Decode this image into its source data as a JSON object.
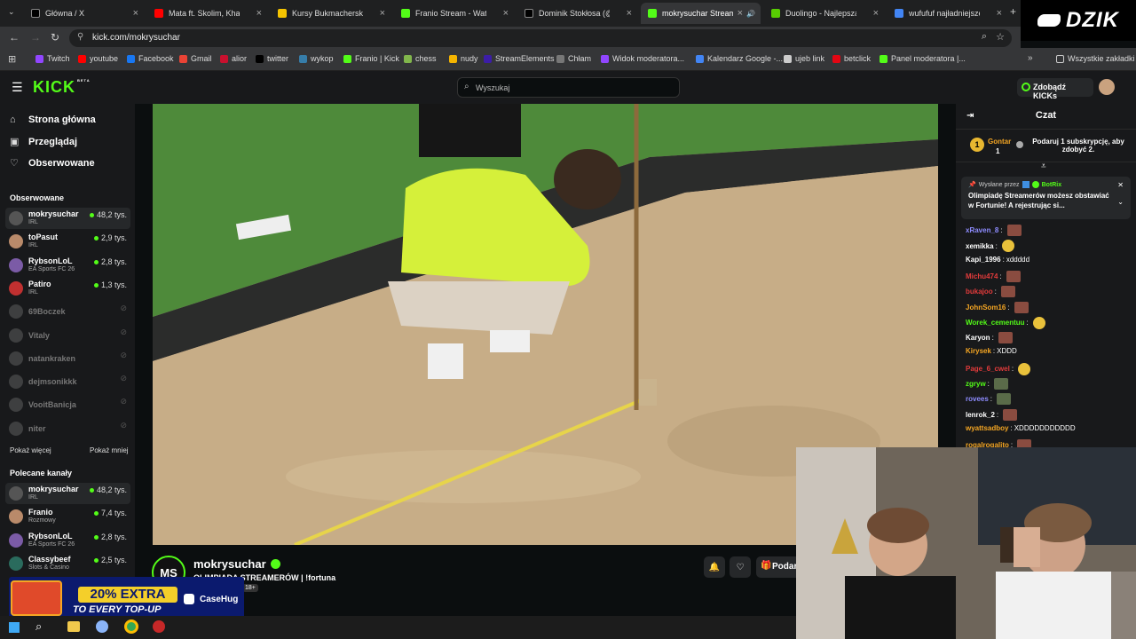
{
  "browser": {
    "tabs": [
      {
        "title": "Główna / X",
        "color": "#000000"
      },
      {
        "title": "Mata ft. Skolim, Khaid - K",
        "color": "#ff0000"
      },
      {
        "title": "Kursy Bukmacherskie Olim",
        "color": "#f5c400"
      },
      {
        "title": "Franio Stream - Watch Liv",
        "color": "#53fc18"
      },
      {
        "title": "Dominik Stokłosa (@Mok",
        "color": "#000000"
      },
      {
        "title": "mokrysuchar Stream",
        "color": "#53fc18"
      },
      {
        "title": "Duolingo - Najlepsza na",
        "color": "#58cc02"
      },
      {
        "title": "wufufuf najładniejsze str",
        "color": "#4285f4"
      }
    ],
    "url": "kick.com/mokrysuchar",
    "bookmarks": [
      {
        "label": "Twitch",
        "color": "#9146ff"
      },
      {
        "label": "youtube",
        "color": "#ff0000"
      },
      {
        "label": "Facebook",
        "color": "#1877f2"
      },
      {
        "label": "Gmail",
        "color": "#ea4335"
      },
      {
        "label": "alior",
        "color": "#c8102e"
      },
      {
        "label": "twitter",
        "color": "#000000"
      },
      {
        "label": "wykop",
        "color": "#367da9"
      },
      {
        "label": "Franio | Kick",
        "color": "#53fc18"
      },
      {
        "label": "chess",
        "color": "#81b64c"
      },
      {
        "label": "nudy",
        "color": "#f4b400"
      },
      {
        "label": "StreamElements",
        "color": "#3c1da8"
      },
      {
        "label": "Chłam",
        "color": "#777777"
      },
      {
        "label": "Widok moderatora...",
        "color": "#9146ff"
      },
      {
        "label": "Kalendarz Google -...",
        "color": "#4285f4"
      },
      {
        "label": "ujeb link",
        "color": "#cccccc"
      },
      {
        "label": "betclick",
        "color": "#e30613"
      },
      {
        "label": "Panel moderatora |...",
        "color": "#53fc18"
      }
    ],
    "all_bookmarks": "Wszystkie zakładki",
    "overlay_brand": "DZIK"
  },
  "kick": {
    "logo": "KICK",
    "logo_sup": "BETA",
    "search_placeholder": "Wyszukaj",
    "get_kicks": "Zdobądź KICKs",
    "nav": [
      {
        "label": "Strona główna",
        "icon": "home-icon"
      },
      {
        "label": "Przeglądaj",
        "icon": "browse-icon"
      },
      {
        "label": "Obserwowane",
        "icon": "heart-icon"
      }
    ],
    "followed_header": "Obserwowane",
    "followed": [
      {
        "name": "mokrysuchar",
        "category": "IRL",
        "viewers": "48,2 tys.",
        "live": true
      },
      {
        "name": "toPasut",
        "category": "IRL",
        "viewers": "2,9 tys.",
        "live": true
      },
      {
        "name": "RybsonLoL",
        "category": "EA Sports FC 26",
        "viewers": "2,8 tys.",
        "live": true
      },
      {
        "name": "Patiro",
        "category": "IRL",
        "viewers": "1,3 tys.",
        "live": true
      },
      {
        "name": "69Boczek",
        "category": "",
        "viewers": "",
        "live": false
      },
      {
        "name": "Vitaly",
        "category": "",
        "viewers": "",
        "live": false
      },
      {
        "name": "natankraken",
        "category": "",
        "viewers": "",
        "live": false
      },
      {
        "name": "dejmsonikkk",
        "category": "",
        "viewers": "",
        "live": false
      },
      {
        "name": "VooitBanicja",
        "category": "",
        "viewers": "",
        "live": false
      },
      {
        "name": "niter",
        "category": "",
        "viewers": "",
        "live": false
      }
    ],
    "show_more": "Pokaż więcej",
    "show_less": "Pokaż mniej",
    "recommended_header": "Polecane kanały",
    "recommended": [
      {
        "name": "mokrysuchar",
        "category": "IRL",
        "viewers": "48,2 tys."
      },
      {
        "name": "Franio",
        "category": "Rozmowy",
        "viewers": "7,4 tys."
      },
      {
        "name": "RybsonLoL",
        "category": "EA Sports FC 26",
        "viewers": "2,8 tys."
      },
      {
        "name": "Classybeef",
        "category": "Slots & Casino",
        "viewers": "2,5 tys."
      }
    ],
    "stream": {
      "avatar_text": "MS",
      "channel": "mokrysuchar",
      "title": "OLIMPIADA STREAMERÓW | !fortuna",
      "badge": "18+",
      "gift_label": "Podar"
    },
    "chat": {
      "title": "Czat",
      "sub_rank": "1",
      "sub_user": "Gontar",
      "sub_count": "1",
      "sub_promo": "Podaruj 1 subskrypcję, aby zdobyć 2.",
      "pinned_by_label": "Wysłane przez",
      "pinned_by": "BotRix",
      "pinned_text": "Olimpiadę Streamerów możesz obstawiać w Fortunie! A rejestrując si...",
      "messages": [
        {
          "user": "xRaven_8",
          "text": "",
          "color": "#8e8cff",
          "emote": "e"
        },
        {
          "user": "xemikka",
          "text": "",
          "color": "#ffffff",
          "emote": "y"
        },
        {
          "user": "Kapi_1996",
          "text": "xddddd",
          "color": "#ffffff",
          "emote": ""
        },
        {
          "user": "Michu474",
          "text": "",
          "color": "#e23b3b",
          "emote": "e"
        },
        {
          "user": "bukajoo",
          "text": "",
          "color": "#e23b3b",
          "emote": "e"
        },
        {
          "user": "JohnSom16",
          "text": "",
          "color": "#f5a623",
          "emote": "e"
        },
        {
          "user": "Worek_cementuu",
          "text": "",
          "color": "#53fc18",
          "emote": "y"
        },
        {
          "user": "Karyon",
          "text": "",
          "color": "#ffffff",
          "emote": "e"
        },
        {
          "user": "Kirysek",
          "text": "XDDD",
          "color": "#f5a623",
          "emote": ""
        },
        {
          "user": "Page_6_cwel",
          "text": "",
          "color": "#e23b3b",
          "emote": "y"
        },
        {
          "user": "zgryw",
          "text": "",
          "color": "#53fc18",
          "emote": "g"
        },
        {
          "user": "rovees",
          "text": "",
          "color": "#8e8cff",
          "emote": "g"
        },
        {
          "user": "lenrok_2",
          "text": "",
          "color": "#ffffff",
          "emote": "e"
        },
        {
          "user": "wyattsadboy",
          "text": "XDDDDDDDDDDD",
          "color": "#f5a623",
          "emote": ""
        },
        {
          "user": "rogalrogalito",
          "text": "",
          "color": "#f5a623",
          "emote": "e"
        }
      ]
    }
  },
  "ad": {
    "headline": "20% EXTRA",
    "subline": "TO EVERY TOP-UP",
    "brand": "CaseHug"
  }
}
